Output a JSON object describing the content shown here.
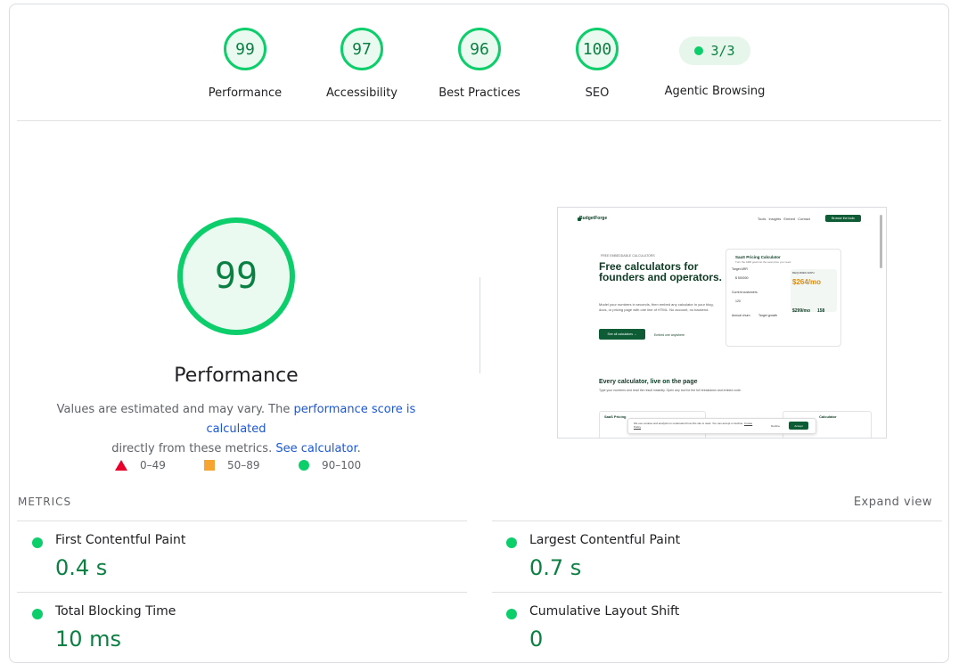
{
  "categories": [
    {
      "label": "Performance",
      "score": "99"
    },
    {
      "label": "Accessibility",
      "score": "97"
    },
    {
      "label": "Best Practices",
      "score": "96"
    },
    {
      "label": "SEO",
      "score": "100"
    },
    {
      "label": "Agentic Browsing",
      "score": "3/3"
    }
  ],
  "performance": {
    "score": "99",
    "title": "Performance",
    "note_part1": "Values are estimated and may vary. The ",
    "note_link1": "performance score is calculated",
    "note_part2": "directly from these metrics. ",
    "note_link2": "See calculator",
    "note_end": "."
  },
  "legend": [
    {
      "range": "0–49",
      "color": "#e8002a"
    },
    {
      "range": "50–89",
      "color": "#f6a532"
    },
    {
      "range": "90–100",
      "color": "#0cce6b"
    }
  ],
  "thumbnail": {
    "brand": "BudgetForge",
    "nav_links": "Tools Insights Embed Contact",
    "nav_cta": "Browse the tools",
    "eyebrow": "FREE EMBEDDABLE CALCULATORS",
    "headline": "Free calculators for founders and operators.",
    "body": "Model your numbers in seconds, then embed any calculator in your blog, docs, or pricing page with one line of HTML. No account, no backend.",
    "btn_primary": "See all calculators →",
    "btn_secondary": "Embed one anywhere",
    "panel_title": "SaaS Pricing Calculator",
    "panel_sub": "Turn the ARR goal into the seat price you need",
    "panel_label1": "Target ARR",
    "panel_value1": "$ 500000",
    "panel_label2": "Current customers",
    "panel_value2": "120",
    "panel_label3": "Annual churn",
    "panel_label4": "Target growth",
    "panel_price": "$264/mo",
    "panel_price_label": "REQUIRED ARPU",
    "panel_sub_value": "$299/mo",
    "panel_sub_value2": "158",
    "section_title": "Every calculator, live on the page",
    "section_body": "Type your numbers and read the result instantly. Open any tool for the full breakdown and embed code.",
    "card1_title": "SaaS Pricing",
    "card2_title": "Calculator",
    "cookie_text": "We use cookies and analytics to understand how this site is used. You can accept or decline.",
    "cookie_link": "Cookie Policy",
    "cookie_decline": "Decline",
    "cookie_accept": "Accept"
  },
  "metrics": {
    "header": "METRICS",
    "expand": "Expand view",
    "items": [
      {
        "label": "First Contentful Paint",
        "value": "0.4 s"
      },
      {
        "label": "Largest Contentful Paint",
        "value": "0.7 s"
      },
      {
        "label": "Total Blocking Time",
        "value": "10 ms"
      },
      {
        "label": "Cumulative Layout Shift",
        "value": "0"
      }
    ]
  },
  "colors": {
    "pass": "#0cce6b",
    "pass_text": "#0b8043",
    "link": "#1a57d6"
  }
}
